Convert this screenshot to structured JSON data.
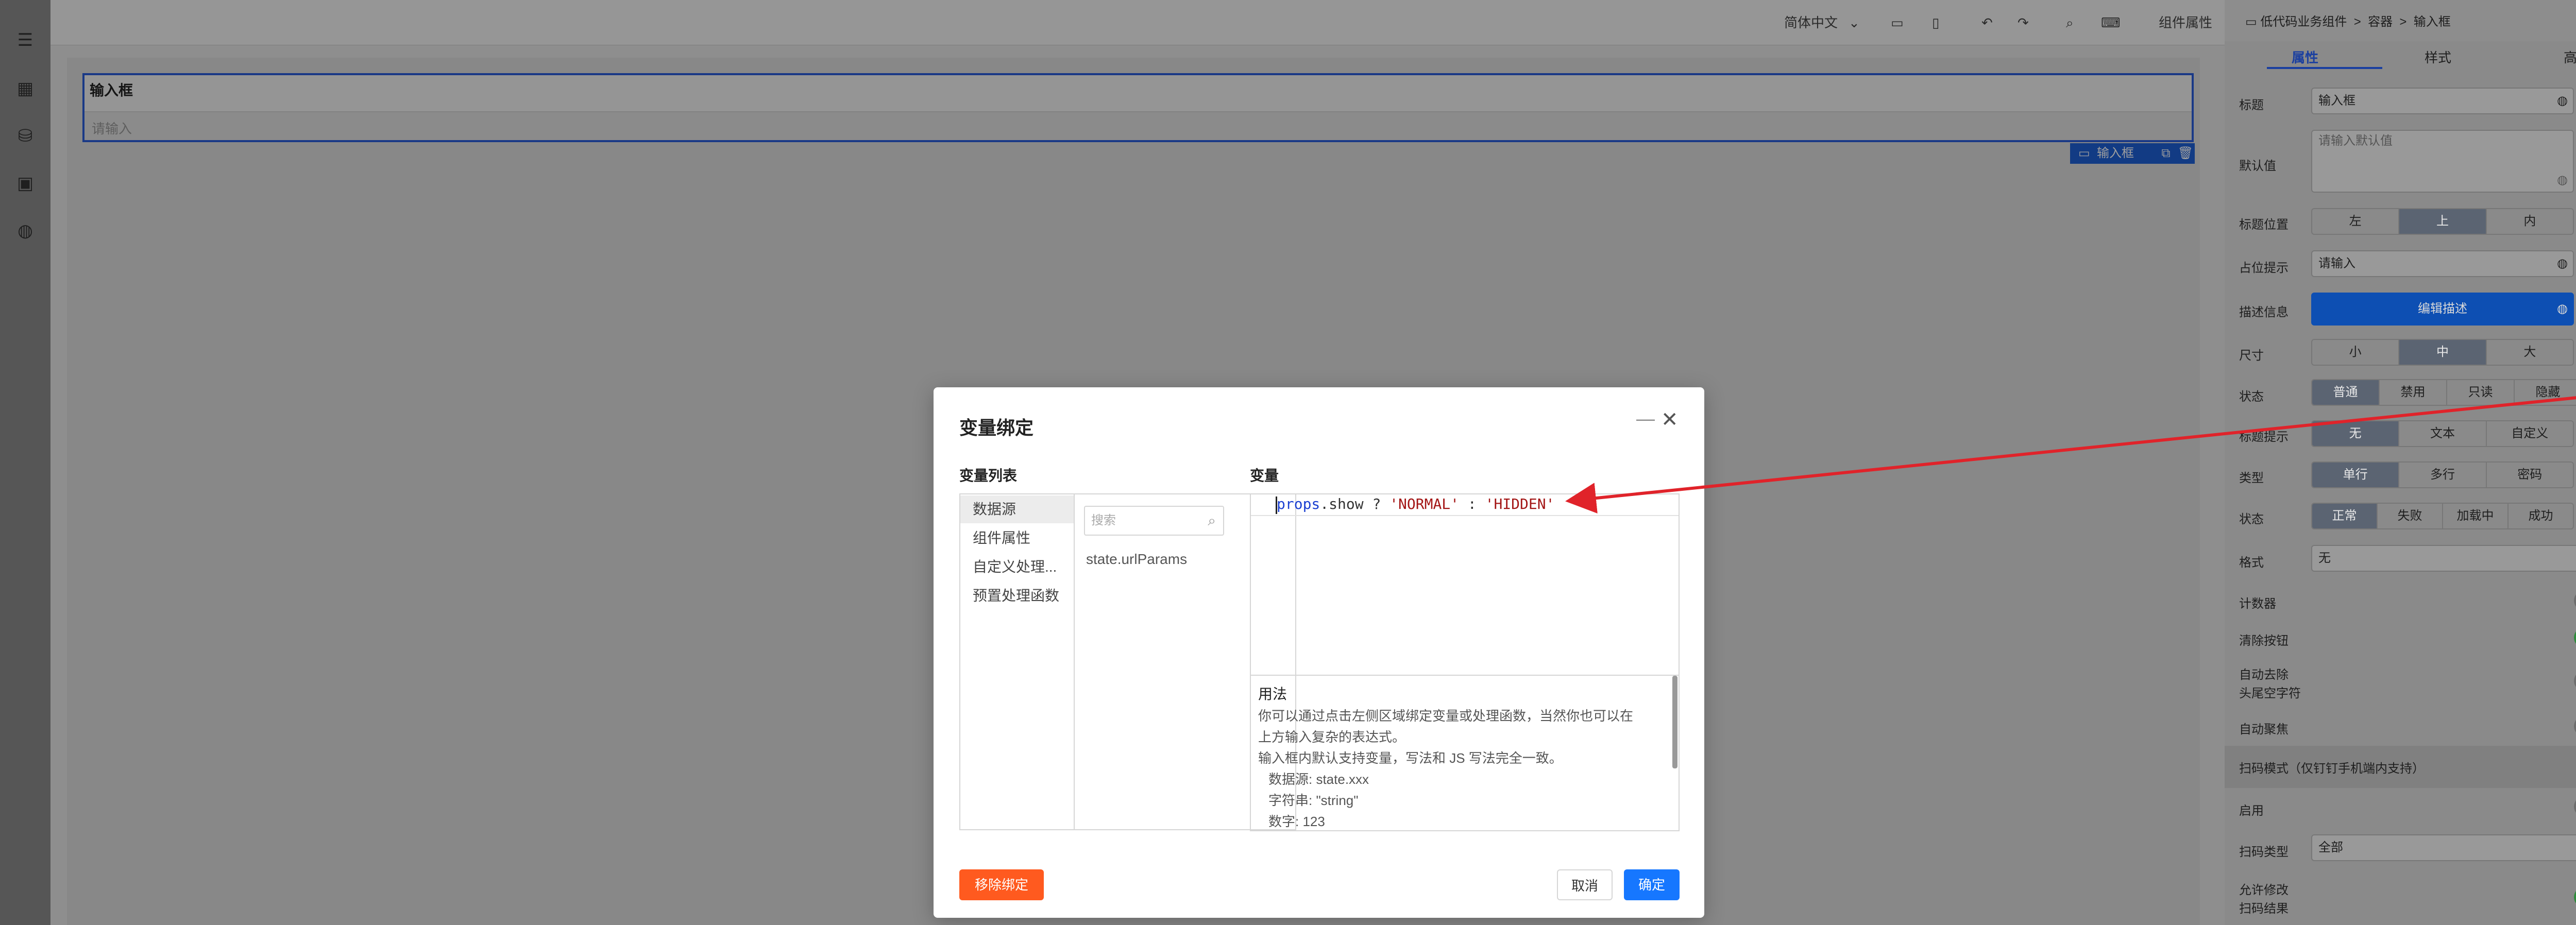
{
  "topbar": {
    "language": "简体中文",
    "component_props": "组件属性"
  },
  "canvas": {
    "component_title": "输入框",
    "component_placeholder": "请输入",
    "component_tag": "输入框"
  },
  "panel": {
    "breadcrumb": [
      "低代码业务组件",
      "容器",
      "输入框"
    ],
    "tabs": [
      "属性",
      "样式",
      "高级"
    ],
    "code_icon": "{/}",
    "rows": {
      "title_label": "标题",
      "title_value": "输入框",
      "default_label": "默认值",
      "default_placeholder": "请输入默认值",
      "title_pos_label": "标题位置",
      "title_pos_options": [
        "左",
        "上",
        "内"
      ],
      "placeholder_label": "占位提示",
      "placeholder_value": "请输入",
      "desc_label": "描述信息",
      "desc_button": "编辑描述",
      "size_label": "尺寸",
      "size_options": [
        "小",
        "中",
        "大"
      ],
      "state_label": "状态",
      "state_options": [
        "普通",
        "禁用",
        "只读",
        "隐藏"
      ],
      "tip_label": "标题提示",
      "tip_options": [
        "无",
        "文本",
        "自定义"
      ],
      "type_label": "类型",
      "type_options": [
        "单行",
        "多行",
        "密码"
      ],
      "status_label": "状态",
      "status_options": [
        "正常",
        "失败",
        "加载中",
        "成功"
      ],
      "format_label": "格式",
      "format_value": "无",
      "counter_label": "计数器",
      "clear_label": "清除按钮",
      "trim_label_1": "自动去除",
      "trim_label_2": "头尾空字符",
      "autofocus_label": "自动聚焦",
      "scan_section": "扫码模式（仅钉钉手机端内支持）",
      "enable_label": "启用",
      "scan_type_label": "扫码类型",
      "scan_type_value": "全部",
      "allow_edit_label_1": "允许修改",
      "allow_edit_label_2": "扫码结果"
    }
  },
  "modal": {
    "title": "变量绑定",
    "list_title": "变量列表",
    "var_title": "变量",
    "categories": [
      "数据源",
      "组件属性",
      "自定义处理...",
      "预置处理函数"
    ],
    "search_placeholder": "搜索",
    "var_item": "state.urlParams",
    "code": {
      "kw": "props",
      "mid": ".show ? ",
      "s1": "'NORMAL'",
      "sep": " : ",
      "s2": "'HIDDEN'"
    },
    "usage_title": "用法",
    "usage_lines": [
      "你可以通过点击左侧区域绑定变量或处理函数，当然你也可以在",
      "上方输入复杂的表达式。",
      "输入框内默认支持变量，写法和 JS 写法完全一致。",
      "  数据源: state.xxx",
      "  字符串: \"string\"",
      "  数字: 123"
    ],
    "remove_btn": "移除绑定",
    "cancel_btn": "取消",
    "ok_btn": "确定"
  },
  "colors": {
    "primary": "#1677ff",
    "danger": "#ff5a1f",
    "annotation": "#e0232a"
  }
}
